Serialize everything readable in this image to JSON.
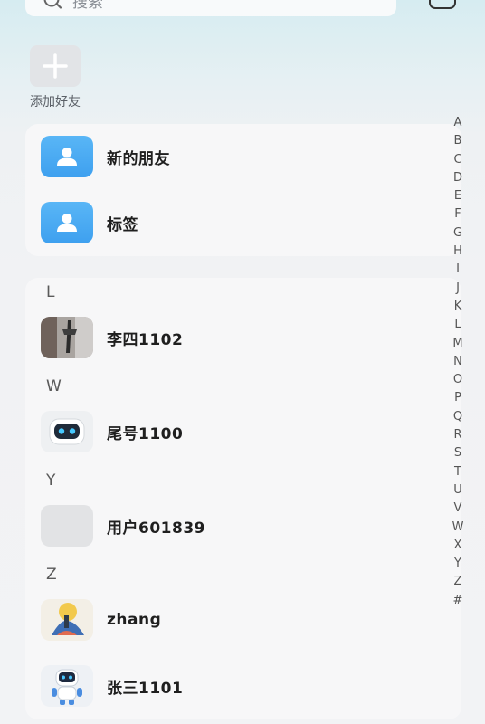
{
  "search": {
    "placeholder": "搜索"
  },
  "add_friend": {
    "label": "添加好友"
  },
  "top_entries": [
    {
      "label": "新的朋友"
    },
    {
      "label": "标签"
    }
  ],
  "contacts": {
    "sections": [
      {
        "letter": "L",
        "items": [
          {
            "name": "李四1102"
          }
        ]
      },
      {
        "letter": "W",
        "items": [
          {
            "name": "尾号1100"
          }
        ]
      },
      {
        "letter": "Y",
        "items": [
          {
            "name": "用户601839"
          }
        ]
      },
      {
        "letter": "Z",
        "items": [
          {
            "name": "zhang"
          },
          {
            "name": "张三1101"
          }
        ]
      }
    ]
  },
  "index_letters": [
    "A",
    "B",
    "C",
    "D",
    "E",
    "F",
    "G",
    "H",
    "I",
    "J",
    "K",
    "L",
    "M",
    "N",
    "O",
    "P",
    "Q",
    "R",
    "S",
    "T",
    "U",
    "V",
    "W",
    "X",
    "Y",
    "Z",
    "#"
  ],
  "colors": {
    "avatar_blue": "#4aa9f2",
    "background": "#f2f3f5"
  }
}
